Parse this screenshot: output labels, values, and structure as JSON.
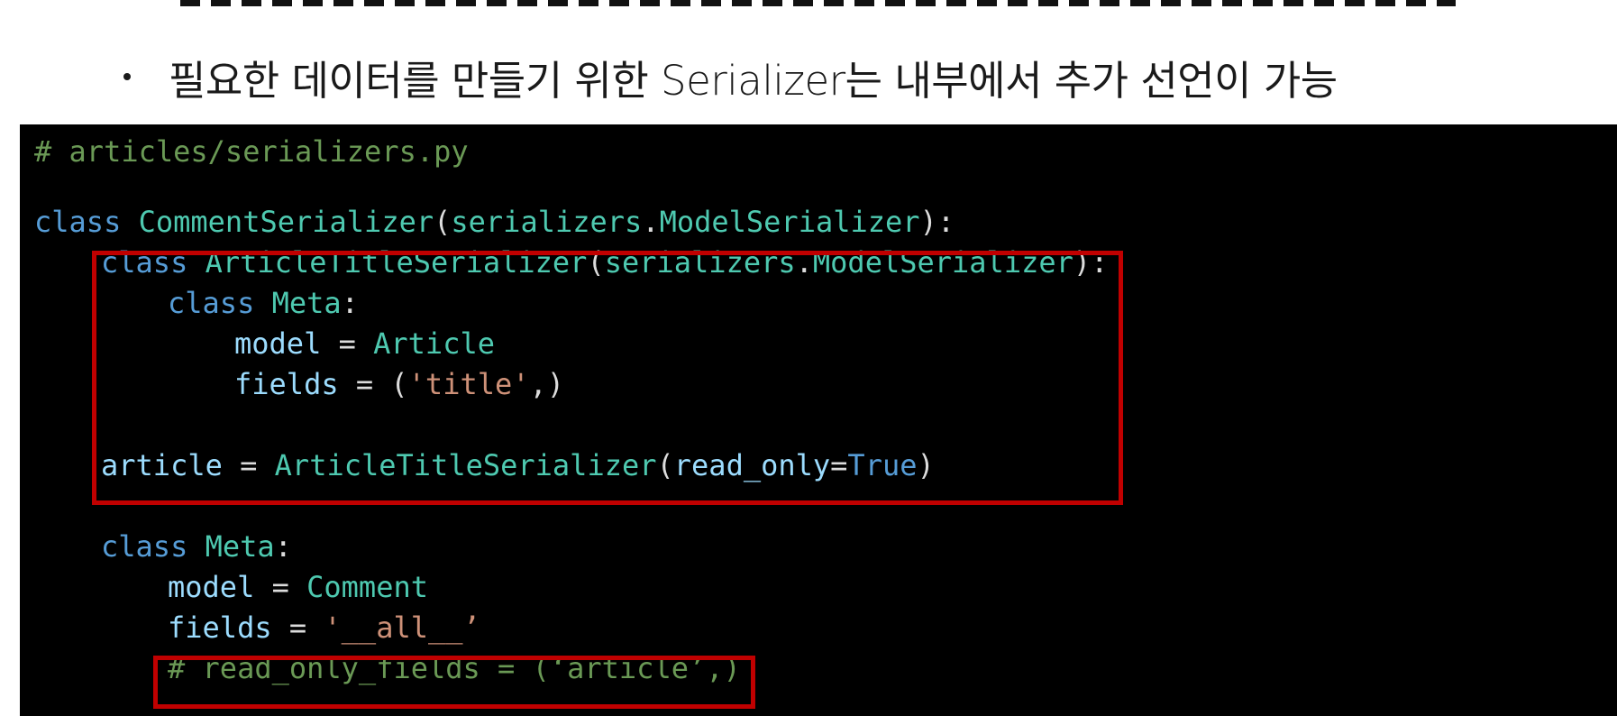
{
  "bullet": {
    "text": "필요한 데이터를 만들기 위한 Serializer는 내부에서 추가 선언이 가능"
  },
  "code": {
    "line1": {
      "comment": "# articles/serializers.py"
    },
    "line3": {
      "kw": "class",
      "name": "CommentSerializer",
      "open": "(",
      "base_mod": "serializers",
      "dot": ".",
      "base_cls": "ModelSerializer",
      "close": "):"
    },
    "line4": {
      "kw": "class",
      "name": "ArticleTitleSerializer",
      "open": "(",
      "base_mod": "serializers",
      "dot": ".",
      "base_cls": "ModelSerializer",
      "close": "):"
    },
    "line5": {
      "kw": "class",
      "name": "Meta",
      "colon": ":"
    },
    "line6": {
      "var": "model",
      "eq": " = ",
      "val": "Article"
    },
    "line7": {
      "var": "fields",
      "eq": " = (",
      "str": "'title'",
      "end": ",)"
    },
    "line9": {
      "var": "article",
      "eq": " = ",
      "cls": "ArticleTitleSerializer",
      "open": "(",
      "arg": "read_only",
      "assign": "=",
      "val": "True",
      "close": ")"
    },
    "line11": {
      "kw": "class",
      "name": "Meta",
      "colon": ":"
    },
    "line12": {
      "var": "model",
      "eq": " = ",
      "val": "Comment"
    },
    "line13": {
      "var": "fields",
      "eq": " = ",
      "str": "'__all__’"
    },
    "line14": {
      "comment": "# read_only_fields = (‘article’,)"
    }
  },
  "colors": {
    "comment": "#6a9955",
    "keyword": "#569cd6",
    "class": "#4ec9b0",
    "variable": "#9cdcfe",
    "string": "#ce9178",
    "highlight": "#c00000",
    "panel_bg": "#000000"
  }
}
